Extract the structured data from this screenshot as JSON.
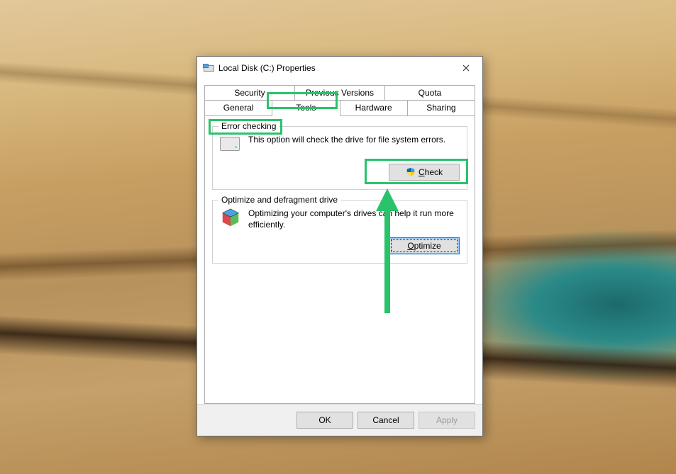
{
  "window": {
    "title": "Local Disk (C:) Properties"
  },
  "tabs": {
    "row1": [
      "Security",
      "Previous Versions",
      "Quota"
    ],
    "row2": [
      "General",
      "Tools",
      "Hardware",
      "Sharing"
    ],
    "active": "Tools"
  },
  "group_error": {
    "legend": "Error checking",
    "text": "This option will check the drive for file system errors.",
    "button": "Check"
  },
  "group_optimize": {
    "legend": "Optimize and defragment drive",
    "text": "Optimizing your computer's drives can help it run more efficiently.",
    "button": "Optimize"
  },
  "footer": {
    "ok": "OK",
    "cancel": "Cancel",
    "apply": "Apply"
  }
}
